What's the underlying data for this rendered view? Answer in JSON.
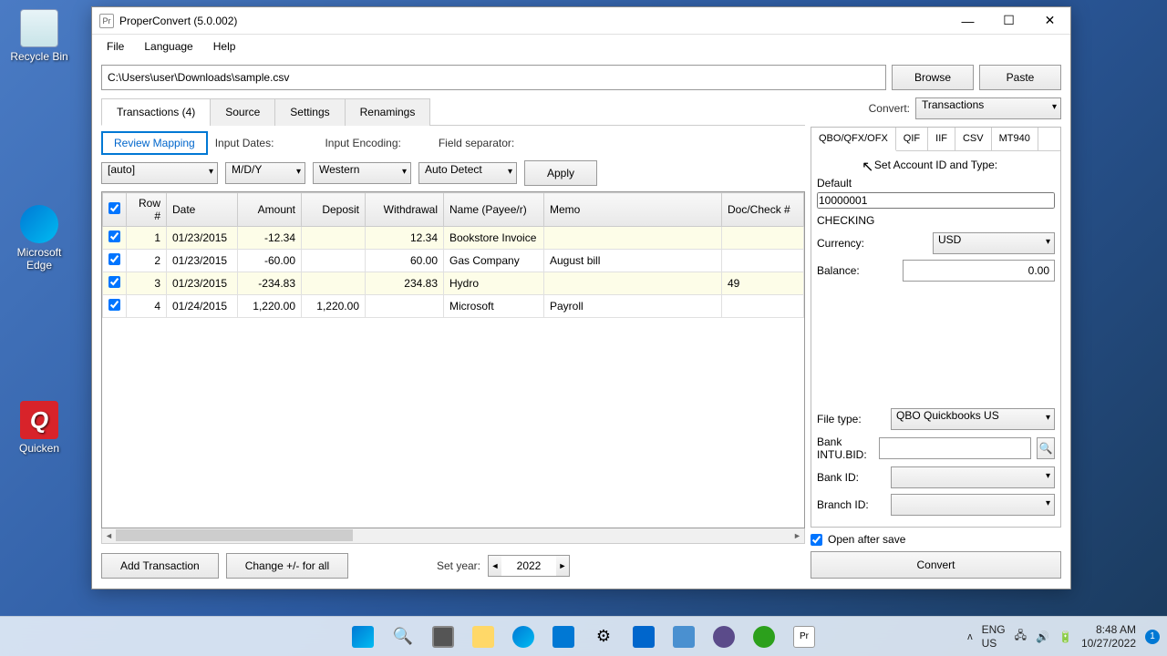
{
  "desktop": {
    "recycle": "Recycle Bin",
    "edge": "Microsoft Edge",
    "quicken": "Quicken"
  },
  "window": {
    "title": "ProperConvert (5.0.002)",
    "menu": {
      "file": "File",
      "language": "Language",
      "help": "Help"
    },
    "path": "C:\\Users\\user\\Downloads\\sample.csv",
    "browse": "Browse",
    "paste": "Paste"
  },
  "tabs": {
    "transactions": "Transactions (4)",
    "source": "Source",
    "settings": "Settings",
    "renamings": "Renamings"
  },
  "controls": {
    "review": "Review Mapping",
    "input_dates": "Input Dates:",
    "encoding": "Input Encoding:",
    "field_sep": "Field separator:",
    "auto": "[auto]",
    "mdy": "M/D/Y",
    "western": "Western",
    "autodetect": "Auto Detect",
    "apply": "Apply"
  },
  "table": {
    "headers": {
      "row": "Row #",
      "date": "Date",
      "amount": "Amount",
      "deposit": "Deposit",
      "withdrawal": "Withdrawal",
      "name": "Name (Payee/r)",
      "memo": "Memo",
      "doc": "Doc/Check #"
    },
    "rows": [
      {
        "n": "1",
        "date": "01/23/2015",
        "amount": "-12.34",
        "deposit": "",
        "withdrawal": "12.34",
        "name": "Bookstore Invoice",
        "memo": "",
        "doc": ""
      },
      {
        "n": "2",
        "date": "01/23/2015",
        "amount": "-60.00",
        "deposit": "",
        "withdrawal": "60.00",
        "name": "Gas Company",
        "memo": "August bill",
        "doc": ""
      },
      {
        "n": "3",
        "date": "01/23/2015",
        "amount": "-234.83",
        "deposit": "",
        "withdrawal": "234.83",
        "name": "Hydro",
        "memo": "",
        "doc": "49"
      },
      {
        "n": "4",
        "date": "01/24/2015",
        "amount": "1,220.00",
        "deposit": "1,220.00",
        "withdrawal": "",
        "name": "Microsoft",
        "memo": "Payroll",
        "doc": ""
      }
    ]
  },
  "footer": {
    "add": "Add Transaction",
    "change": "Change +/- for all",
    "setyear": "Set year:",
    "year": "2022"
  },
  "convert": {
    "label": "Convert:",
    "value": "Transactions",
    "formats": {
      "qbo": "QBO/QFX/OFX",
      "qif": "QIF",
      "iif": "IIF",
      "csv": "CSV",
      "mt940": "MT940"
    },
    "set_account": "Set Account ID and Type:",
    "default": "Default",
    "account_id": "10000001",
    "account_type": "CHECKING",
    "currency_label": "Currency:",
    "currency": "USD",
    "balance_label": "Balance:",
    "balance": "0.00",
    "filetype_label": "File type:",
    "filetype": "QBO Quickbooks US",
    "intubid": "Bank INTU.BID:",
    "bankid": "Bank ID:",
    "branchid": "Branch ID:",
    "open_after": "Open after save",
    "convert_btn": "Convert"
  },
  "taskbar": {
    "lang": "ENG",
    "locale": "US",
    "time": "8:48 AM",
    "date": "10/27/2022"
  }
}
